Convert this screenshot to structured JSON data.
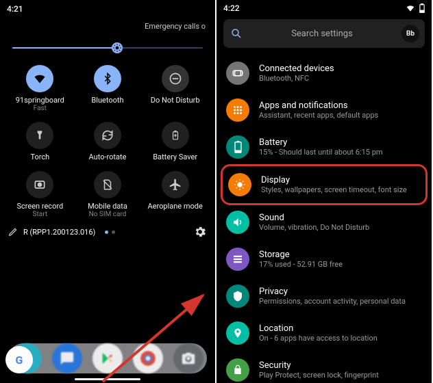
{
  "left": {
    "status_time": "4:21",
    "emergency": "Emergency calls o",
    "brightness_percent": 55,
    "tiles": [
      {
        "label": "91springboard",
        "sub": "Fast",
        "icon": "wifi",
        "active": true
      },
      {
        "label": "Bluetooth",
        "sub": "",
        "icon": "bluetooth",
        "active": true
      },
      {
        "label": "Do Not Disturb",
        "sub": "",
        "icon": "dnd",
        "active": false
      },
      {
        "label": "Torch",
        "sub": "",
        "icon": "torch",
        "active": false
      },
      {
        "label": "Auto-rotate",
        "sub": "",
        "icon": "rotate",
        "active": false
      },
      {
        "label": "Battery Saver",
        "sub": "",
        "icon": "batterysaver",
        "active": false
      },
      {
        "label": "Screen record",
        "sub": "Start",
        "icon": "record",
        "active": false
      },
      {
        "label": "Mobile data",
        "sub": "No SIM card",
        "icon": "nosim",
        "active": false
      },
      {
        "label": "Aeroplane mode",
        "sub": "",
        "icon": "airplane",
        "active": false
      }
    ],
    "build": "R (RPP1.200123.016)",
    "dock": [
      "phone",
      "messages",
      "play",
      "chrome",
      "camera"
    ]
  },
  "right": {
    "status_time": "4:22",
    "search_placeholder": "Search settings",
    "avatar_label": "Bb",
    "items": [
      {
        "title": "Connected devices",
        "desc": "Bluetooth, NFC",
        "color": "#757575",
        "icon": "link"
      },
      {
        "title": "Apps and notifications",
        "desc": "Assistant, recent apps, default apps",
        "color": "#f57c00",
        "icon": "grid"
      },
      {
        "title": "Battery",
        "desc": "15% - Should last until about 6:15 pm",
        "color": "#00897b",
        "icon": "battery"
      },
      {
        "title": "Display",
        "desc": "Styles, wallpapers, screen timeout, font size",
        "color": "#f57c00",
        "icon": "display",
        "highlighted": true
      },
      {
        "title": "Sound",
        "desc": "Volume, vibration, Do Not Disturb",
        "color": "#00bfa5",
        "icon": "sound"
      },
      {
        "title": "Storage",
        "desc": "17% used - 52.91 GB free",
        "color": "#7e57c2",
        "icon": "storage"
      },
      {
        "title": "Privacy",
        "desc": "Permissions, account activity, personal data",
        "color": "#00897b",
        "icon": "privacy"
      },
      {
        "title": "Location",
        "desc": "On - 6 apps have access to location",
        "color": "#00bfa5",
        "icon": "location"
      },
      {
        "title": "Security",
        "desc": "Play Protect, screen lock, fingerprint",
        "color": "#43a047",
        "icon": "security"
      }
    ]
  }
}
